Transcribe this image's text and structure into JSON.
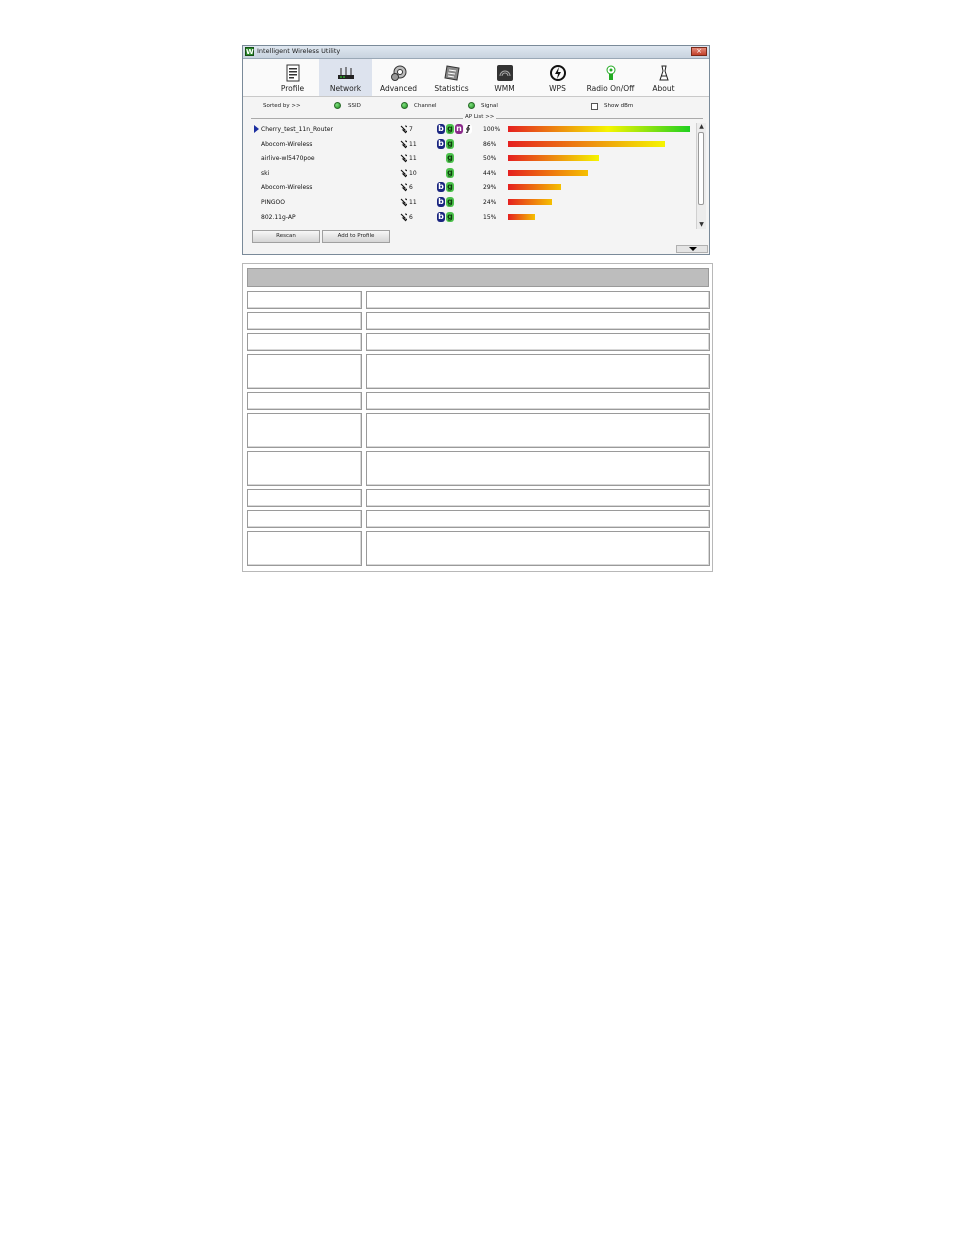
{
  "window": {
    "title": "Intelligent Wireless Utility",
    "close_symbol": "×"
  },
  "toolbar": {
    "items": [
      {
        "label": "Profile",
        "icon": "profile-icon"
      },
      {
        "label": "Network",
        "icon": "router-icon",
        "active": true
      },
      {
        "label": "Advanced",
        "icon": "advanced-icon"
      },
      {
        "label": "Statistics",
        "icon": "statistics-icon"
      },
      {
        "label": "WMM",
        "icon": "wmm-icon"
      },
      {
        "label": "WPS",
        "icon": "wps-icon"
      },
      {
        "label": "Radio On/Off",
        "icon": "radio-icon"
      },
      {
        "label": "About",
        "icon": "about-icon"
      }
    ]
  },
  "sort": {
    "label": "Sorted by >>",
    "options": [
      "SSID",
      "Channel",
      "Signal"
    ],
    "show_dbm": "Show dBm"
  },
  "ap_list": {
    "title": "AP List >>",
    "rows": [
      {
        "ssid": "Cherry_test_11n_Router",
        "channel": "7",
        "modes": [
          "b",
          "g",
          "n",
          "wps"
        ],
        "signal": "100%",
        "signal_value": 100,
        "selected": true
      },
      {
        "ssid": "Abocom-Wireless",
        "channel": "11",
        "modes": [
          "b",
          "g"
        ],
        "signal": "86%",
        "signal_value": 86
      },
      {
        "ssid": "airlive-wl5470poe",
        "channel": "11",
        "modes": [
          "g"
        ],
        "signal": "50%",
        "signal_value": 50
      },
      {
        "ssid": "ski",
        "channel": "10",
        "modes": [
          "g"
        ],
        "signal": "44%",
        "signal_value": 44
      },
      {
        "ssid": "Abocom-Wireless",
        "channel": "6",
        "modes": [
          "b",
          "g"
        ],
        "signal": "29%",
        "signal_value": 29
      },
      {
        "ssid": "PINGOO",
        "channel": "11",
        "modes": [
          "b",
          "g"
        ],
        "signal": "24%",
        "signal_value": 24
      },
      {
        "ssid": "802.11g-AP",
        "channel": "6",
        "modes": [
          "b",
          "g"
        ],
        "signal": "15%",
        "signal_value": 15
      }
    ]
  },
  "buttons": {
    "rescan": "Rescan",
    "add_to_profile": "Add to Profile"
  },
  "colors": {
    "signal_low": "#e52020",
    "signal_mid": "#f5f500",
    "signal_high": "#20d020",
    "accent": "#1c2fa0"
  },
  "table": {
    "header": "",
    "rows": [
      {
        "term": "",
        "desc": ""
      },
      {
        "term": "",
        "desc": ""
      },
      {
        "term": "",
        "desc": ""
      },
      {
        "term": "",
        "desc": ""
      },
      {
        "term": "",
        "desc": ""
      },
      {
        "term": "",
        "desc": ""
      },
      {
        "term": "",
        "desc": ""
      },
      {
        "term": "",
        "desc": ""
      },
      {
        "term": "",
        "desc": ""
      },
      {
        "term": "",
        "desc": ""
      }
    ]
  }
}
